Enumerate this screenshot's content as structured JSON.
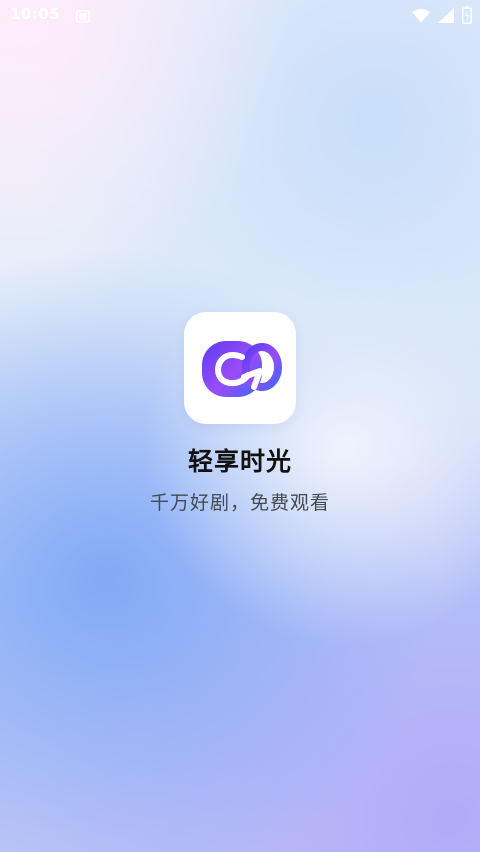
{
  "status_bar": {
    "time": "10:05",
    "icons": [
      "notification-icon",
      "wifi-icon",
      "signal-icon",
      "battery-icon"
    ],
    "color": "#ffffff"
  },
  "splash": {
    "app_name": "轻享时光",
    "slogan": "千万好剧，免费观看",
    "logo_icon": "app-logo-icon",
    "logo_colors": [
      "#5a3cf2",
      "#9a4cf6",
      "#3e66ff"
    ]
  },
  "background": {
    "colors": [
      "#fbe9f7",
      "#dce8f9",
      "#8fb2f6",
      "#b8b6f7"
    ]
  }
}
